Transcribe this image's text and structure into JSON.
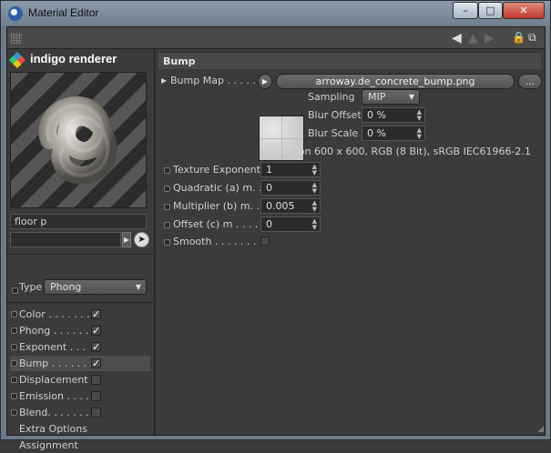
{
  "window": {
    "title": "Material Editor",
    "minimize": "–",
    "maximize": "□",
    "close": "✕"
  },
  "toolbar": {
    "back_arrow": "◀",
    "forward_arrow": "▶",
    "lock": "🔒",
    "new_window": "⧉"
  },
  "left": {
    "brand": "indigo renderer",
    "material_name": "floor p",
    "type_label": "Type",
    "type_value": "Phong",
    "channels": [
      {
        "label": "Color . . . . . . .",
        "checked": true
      },
      {
        "label": "Phong . . . . . . .",
        "checked": true
      },
      {
        "label": "Exponent . . .",
        "checked": true
      },
      {
        "label": "Bump . . . . . . . .",
        "checked": true
      },
      {
        "label": "Displacement",
        "checked": false
      },
      {
        "label": "Emission . . . .",
        "checked": false
      },
      {
        "label": "Blend. . . . . . . .",
        "checked": false
      },
      {
        "label": "Extra Options",
        "checked": null
      },
      {
        "label": "Assignment",
        "checked": null
      }
    ],
    "check_mark": "✓"
  },
  "right": {
    "section_title": "Bump",
    "bump_map_label": "Bump Map . . . . .",
    "bump_map_file": "arroway.de_concrete_bump.png",
    "bump_map_more": "...",
    "sampling_label": "Sampling",
    "sampling_value": "MIP",
    "blur_offset_label": "Blur Offset",
    "blur_offset_value": "0 %",
    "blur_scale_label": "Blur Scale",
    "blur_scale_value": "0 %",
    "resolution_text": "Resolution 600 x 600, RGB (8 Bit), sRGB IEC61966-2.1",
    "texture_exponent_label": "Texture Exponent",
    "texture_exponent_value": "1",
    "quadratic_label": "Quadratic (a) m. .",
    "quadratic_value": "0",
    "multiplier_label": "Multiplier (b) m. .",
    "multiplier_value": "0.005",
    "offset_label": "Offset (c) m . . . . .",
    "offset_value": "0",
    "smooth_label": "Smooth . . . . . . . . .",
    "smooth_checked": false
  }
}
